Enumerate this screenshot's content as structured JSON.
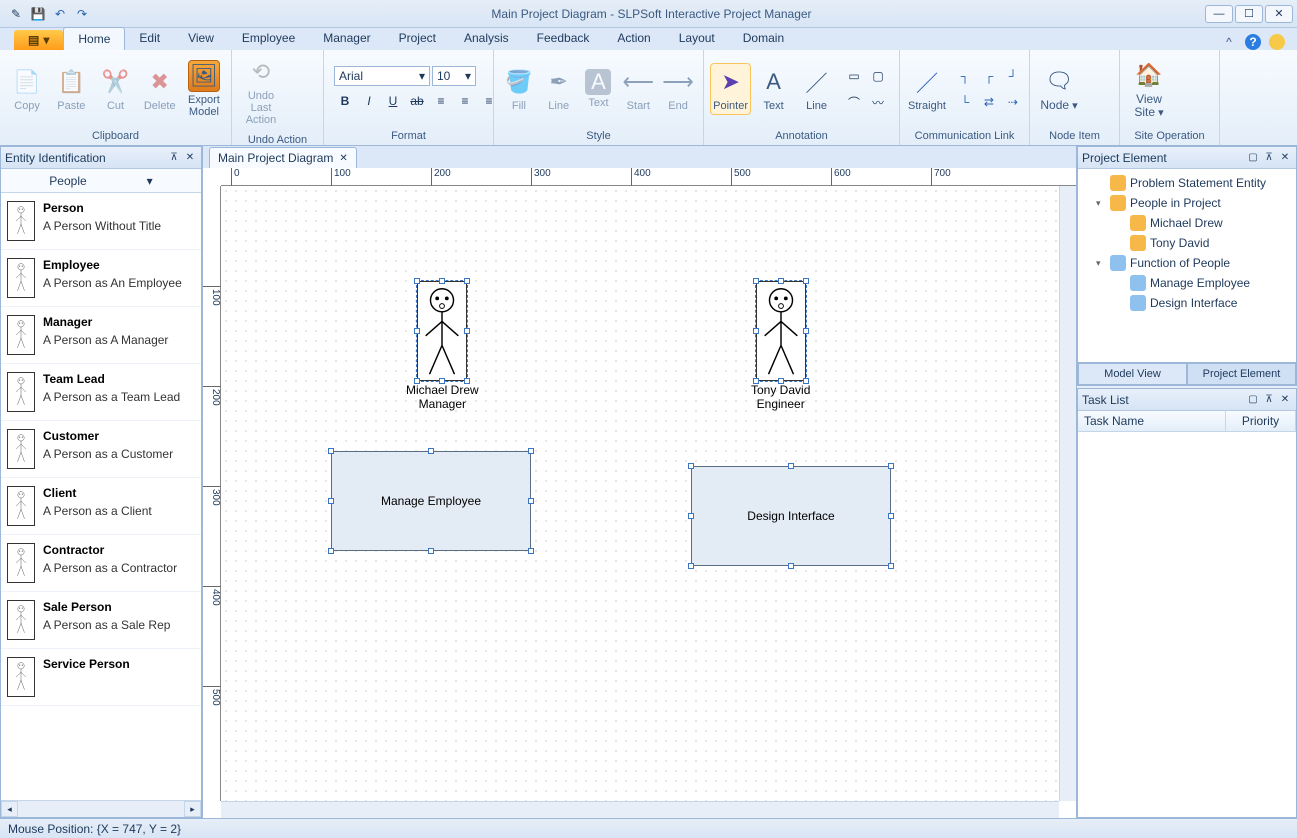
{
  "title": "Main Project Diagram - SLPSoft Interactive Project Manager",
  "ribbon_tabs": [
    "Home",
    "Edit",
    "View",
    "Employee",
    "Manager",
    "Project",
    "Analysis",
    "Feedback",
    "Action",
    "Layout",
    "Domain"
  ],
  "active_tab": "Home",
  "groups": {
    "clipboard": {
      "label": "Clipboard",
      "copy": "Copy",
      "paste": "Paste",
      "cut": "Cut",
      "delete": "Delete",
      "export": "Export Model"
    },
    "undo": {
      "label": "Undo Action",
      "undo": "Undo Last Action"
    },
    "format": {
      "label": "Format",
      "font": "Arial",
      "size": "10"
    },
    "style": {
      "label": "Style",
      "fill": "Fill",
      "line": "Line",
      "text": "Text",
      "start": "Start",
      "end": "End"
    },
    "annotation": {
      "label": "Annotation",
      "pointer": "Pointer",
      "text": "Text",
      "line": "Line"
    },
    "comm": {
      "label": "Communication Link",
      "straight": "Straight"
    },
    "node": {
      "label": "Node Item",
      "node": "Node"
    },
    "site": {
      "label": "Site Operation",
      "view": "View Site"
    }
  },
  "left_panel": {
    "title": "Entity Identification",
    "filter": "People",
    "items": [
      {
        "name": "Person",
        "desc": "A Person Without Title"
      },
      {
        "name": "Employee",
        "desc": "A Person as An Employee"
      },
      {
        "name": "Manager",
        "desc": "A Person as A Manager"
      },
      {
        "name": "Team Lead",
        "desc": "A Person as a Team Lead"
      },
      {
        "name": "Customer",
        "desc": "A Person as a Customer"
      },
      {
        "name": "Client",
        "desc": "A Person as a Client"
      },
      {
        "name": "Contractor",
        "desc": "A Person as a Contractor"
      },
      {
        "name": "Sale Person",
        "desc": "A Person as a Sale Rep"
      },
      {
        "name": "Service Person",
        "desc": ""
      }
    ]
  },
  "doc_tab": "Main Project Diagram",
  "ruler_marks": [
    "0",
    "100",
    "200",
    "300",
    "400",
    "500",
    "600",
    "700"
  ],
  "ruler_marks_v": [
    "100",
    "200",
    "300",
    "400",
    "500"
  ],
  "diagram": {
    "person1": {
      "name": "Michael Drew",
      "role": "Manager"
    },
    "person2": {
      "name": "Tony David",
      "role": "Engineer"
    },
    "box1": "Manage Employee",
    "box2": "Design Interface"
  },
  "right_panel": {
    "title": "Project Element",
    "tree": [
      {
        "label": "Problem Statement Entity",
        "icon": "#f7b84a",
        "level": 0,
        "tw": ""
      },
      {
        "label": "People in Project",
        "icon": "#f7b84a",
        "level": 0,
        "tw": "▾"
      },
      {
        "label": "Michael Drew",
        "icon": "#f7b84a",
        "level": 1,
        "tw": ""
      },
      {
        "label": "Tony David",
        "icon": "#f7b84a",
        "level": 1,
        "tw": ""
      },
      {
        "label": "Function of People",
        "icon": "#8fc1ef",
        "level": 0,
        "tw": "▾"
      },
      {
        "label": "Manage Employee",
        "icon": "#8fc1ef",
        "level": 1,
        "tw": ""
      },
      {
        "label": "Design Interface",
        "icon": "#8fc1ef",
        "level": 1,
        "tw": ""
      }
    ],
    "tabs": [
      "Model View",
      "Project Element"
    ],
    "active_tab": "Project Element"
  },
  "task_panel": {
    "title": "Task List",
    "cols": [
      "Task Name",
      "Priority"
    ]
  },
  "status": "Mouse Position: {X = 747,  Y = 2}"
}
